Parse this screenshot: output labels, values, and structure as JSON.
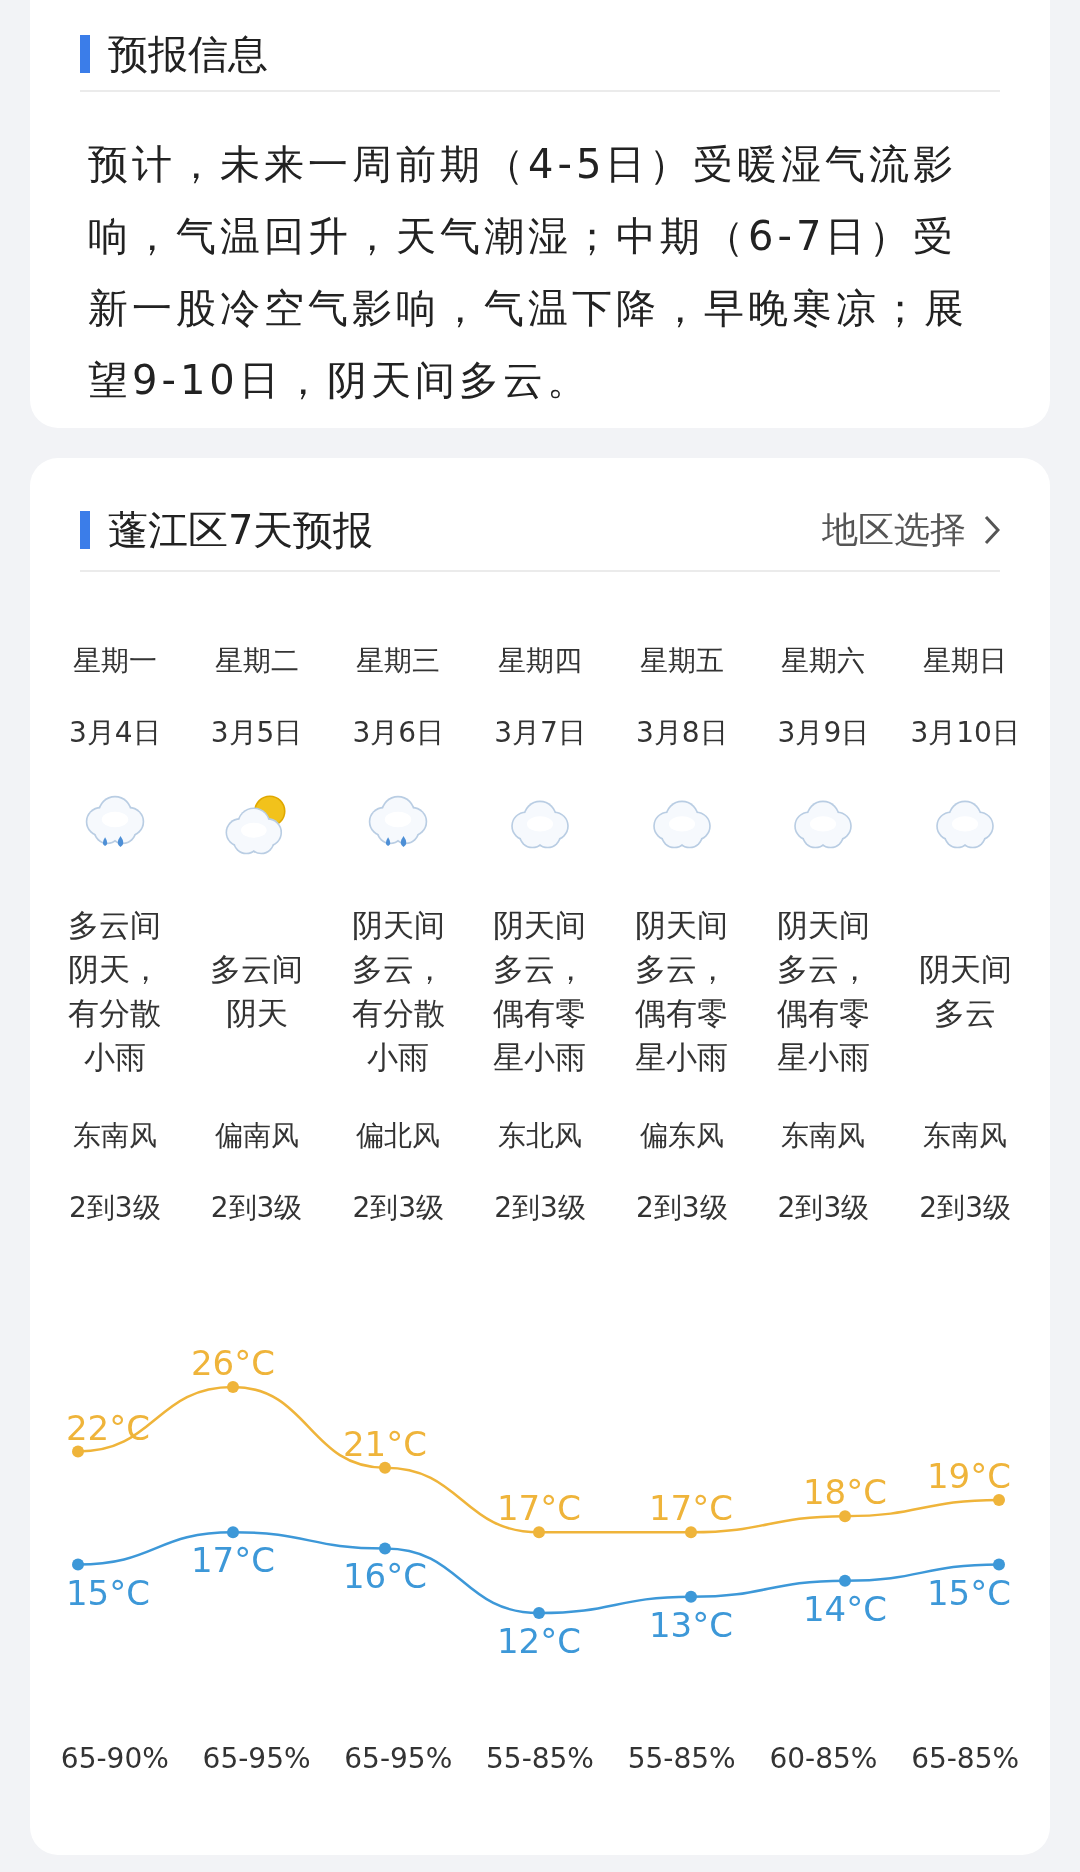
{
  "forecast_info": {
    "title": "预报信息",
    "text": "预计，未来一周前期（4-5日）受暖湿气流影响，气温回升，天气潮湿；中期（6-7日）受新一股冷空气影响，气温下降，早晚寒凉；展望9-10日，阴天间多云。"
  },
  "forecast_7day": {
    "title": "蓬江区7天预报",
    "region_link": "地区选择",
    "days": [
      {
        "weekday": "星期一",
        "date": "3月4日",
        "kind": "rain",
        "description": "多云间阴天，有分散小雨",
        "wind_direction": "东南风",
        "wind_level": "2到3级",
        "humidity": "65-90%"
      },
      {
        "weekday": "星期二",
        "date": "3月5日",
        "kind": "partly",
        "description": "多云间阴天",
        "wind_direction": "偏南风",
        "wind_level": "2到3级",
        "humidity": "65-95%"
      },
      {
        "weekday": "星期三",
        "date": "3月6日",
        "kind": "rain",
        "description": "阴天间多云，有分散小雨",
        "wind_direction": "偏北风",
        "wind_level": "2到3级",
        "humidity": "65-95%"
      },
      {
        "weekday": "星期四",
        "date": "3月7日",
        "kind": "cloud",
        "description": "阴天间多云，偶有零星小雨",
        "wind_direction": "东北风",
        "wind_level": "2到3级",
        "humidity": "55-85%"
      },
      {
        "weekday": "星期五",
        "date": "3月8日",
        "kind": "cloud",
        "description": "阴天间多云，偶有零星小雨",
        "wind_direction": "偏东风",
        "wind_level": "2到3级",
        "humidity": "55-85%"
      },
      {
        "weekday": "星期六",
        "date": "3月9日",
        "kind": "cloud",
        "description": "阴天间多云，偶有零星小雨",
        "wind_direction": "东南风",
        "wind_level": "2到3级",
        "humidity": "60-85%"
      },
      {
        "weekday": "星期日",
        "date": "3月10日",
        "kind": "cloud",
        "description": "阴天间多云",
        "wind_direction": "东南风",
        "wind_level": "2到3级",
        "humidity": "65-85%"
      }
    ],
    "chart_data": {
      "type": "line",
      "series": [
        {
          "color": "#efb43a",
          "values": [
            22,
            26,
            21,
            17,
            17,
            18,
            19
          ],
          "value_labels": [
            "22°C",
            "26°C",
            "21°C",
            "17°C",
            "17°C",
            "18°C",
            "19°C"
          ],
          "marker": true
        },
        {
          "color": "#3d98d8",
          "values": [
            15,
            17,
            16,
            12,
            13,
            14,
            15
          ],
          "value_labels": [
            "15°C",
            "17°C",
            "16°C",
            "12°C",
            "13°C",
            "14°C",
            "15°C"
          ],
          "marker": true
        }
      ]
    }
  }
}
